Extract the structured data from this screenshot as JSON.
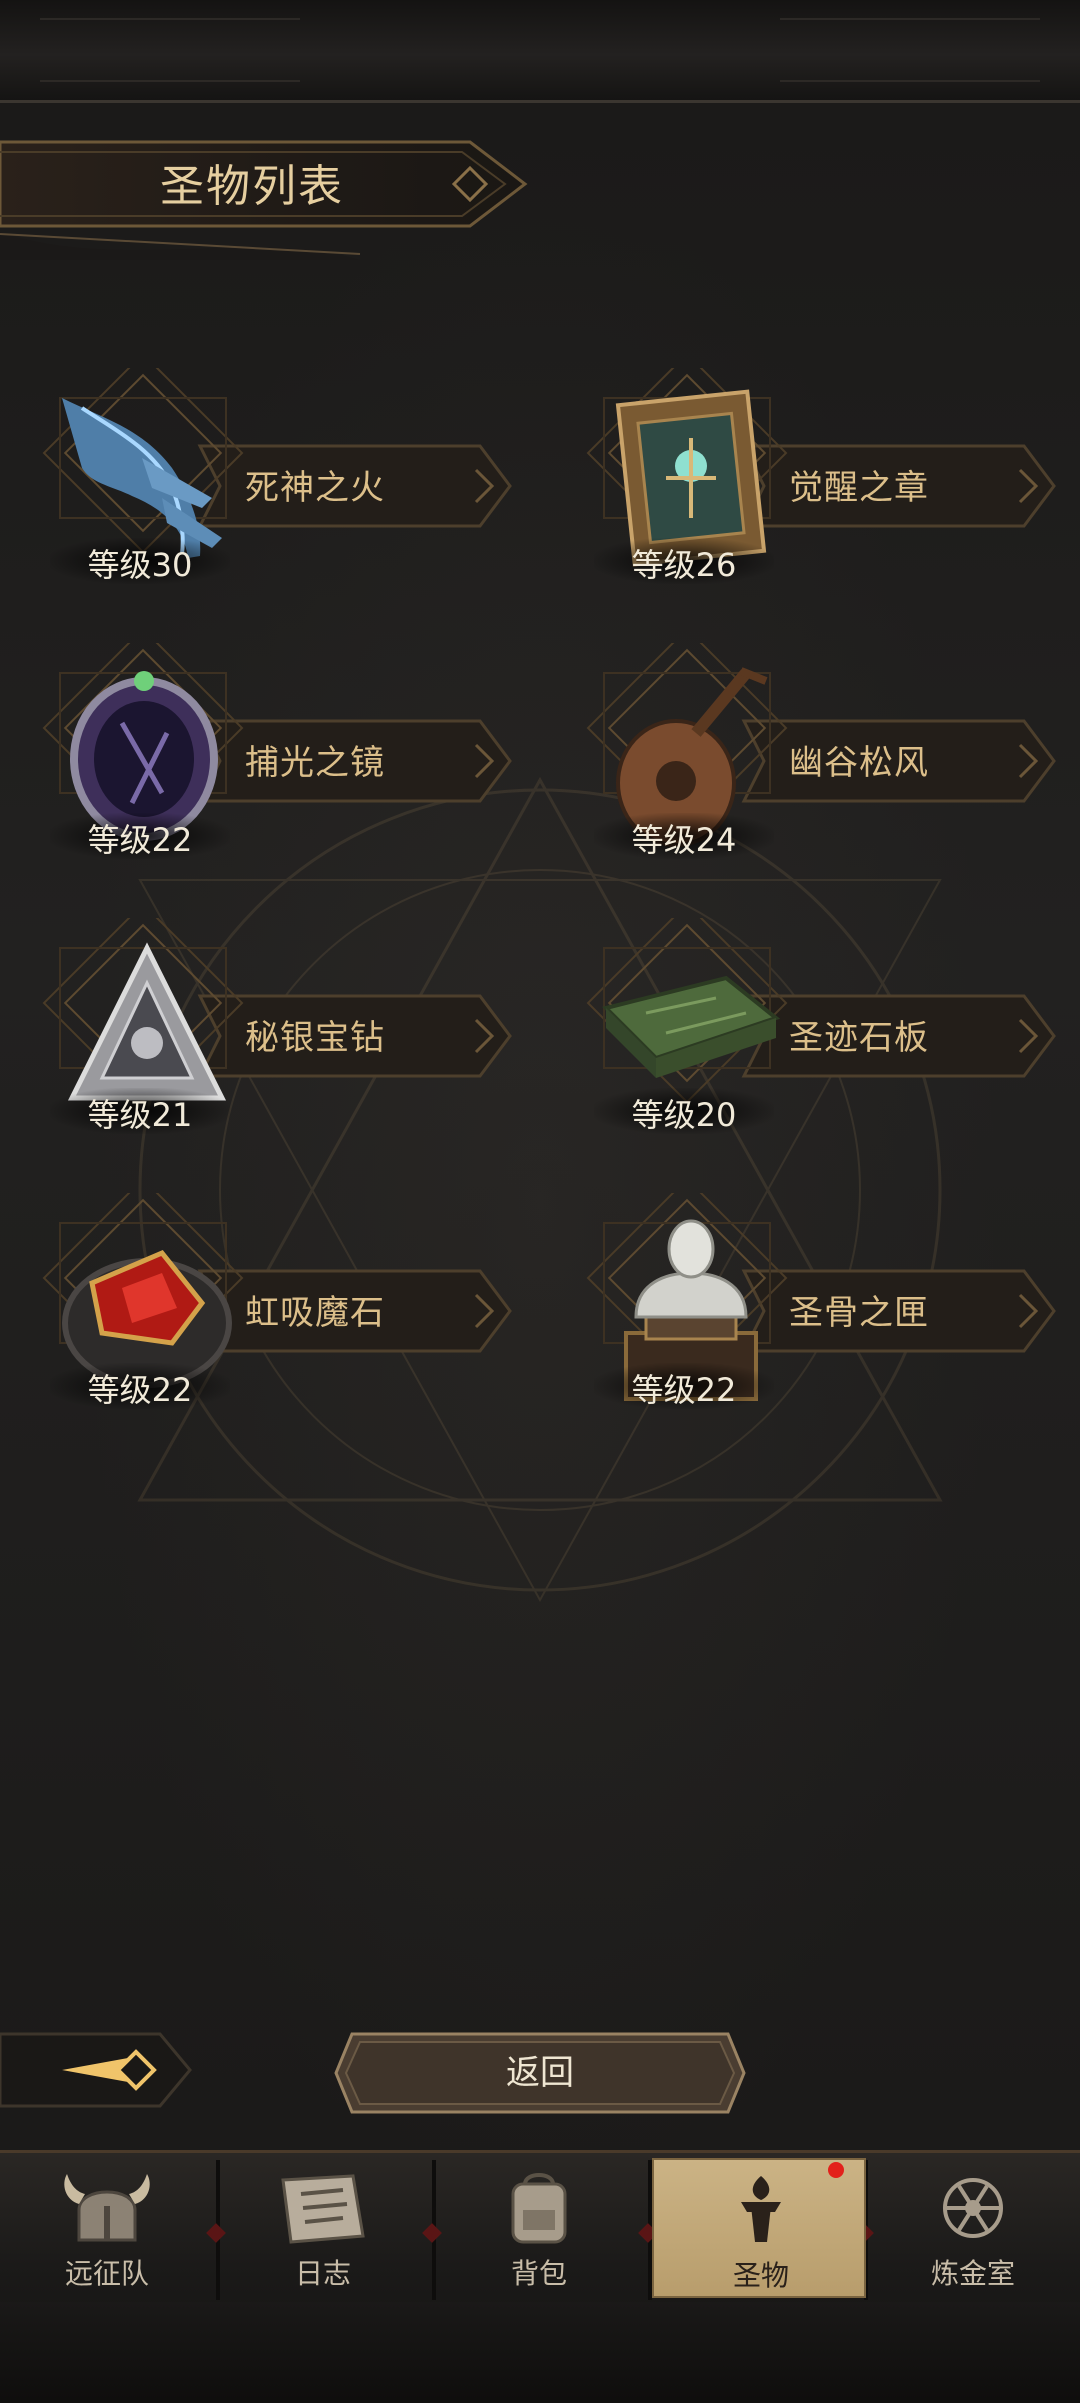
{
  "header": {
    "title": "圣物列表"
  },
  "relics": [
    {
      "name": "死神之火",
      "level": "等级30"
    },
    {
      "name": "觉醒之章",
      "level": "等级26"
    },
    {
      "name": "捕光之镜",
      "level": "等级22"
    },
    {
      "name": "幽谷松风",
      "level": "等级24"
    },
    {
      "name": "秘银宝钻",
      "level": "等级21"
    },
    {
      "name": "圣迹石板",
      "level": "等级20"
    },
    {
      "name": "虹吸魔石",
      "level": "等级22"
    },
    {
      "name": "圣骨之匣",
      "level": "等级22"
    }
  ],
  "actions": {
    "back_label": "返回"
  },
  "nav": {
    "items": [
      {
        "label": "远征队",
        "icon": "viking-helmet-icon"
      },
      {
        "label": "日志",
        "icon": "scroll-icon"
      },
      {
        "label": "背包",
        "icon": "backpack-icon"
      },
      {
        "label": "圣物",
        "icon": "torch-icon"
      },
      {
        "label": "炼金室",
        "icon": "alchemy-icon"
      }
    ],
    "active_index": 3
  },
  "colors": {
    "accent": "#d9c39a",
    "active_tab": "#c4ab7b",
    "badge": "#e3201b"
  }
}
